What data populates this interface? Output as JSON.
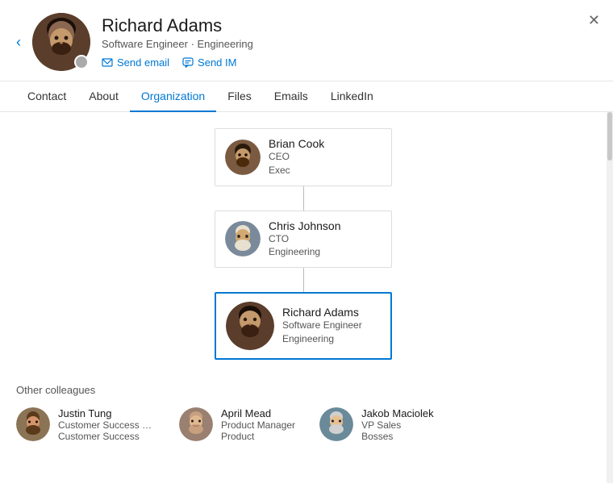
{
  "header": {
    "back_label": "‹",
    "close_label": "✕",
    "profile": {
      "name": "Richard Adams",
      "subtitle": "Software Engineer · Engineering",
      "send_email_label": "Send email",
      "send_im_label": "Send IM"
    }
  },
  "tabs": [
    {
      "id": "contact",
      "label": "Contact",
      "active": false
    },
    {
      "id": "about",
      "label": "About",
      "active": false
    },
    {
      "id": "organization",
      "label": "Organization",
      "active": true
    },
    {
      "id": "files",
      "label": "Files",
      "active": false
    },
    {
      "id": "emails",
      "label": "Emails",
      "active": false
    },
    {
      "id": "linkedin",
      "label": "LinkedIn",
      "active": false
    }
  ],
  "org_chart": {
    "nodes": [
      {
        "id": "brian",
        "name": "Brian Cook",
        "title": "CEO",
        "dept": "Exec",
        "current": false
      },
      {
        "id": "chris",
        "name": "Chris Johnson",
        "title": "CTO",
        "dept": "Engineering",
        "current": false
      },
      {
        "id": "richard",
        "name": "Richard Adams",
        "title": "Software Engineer",
        "dept": "Engineering",
        "current": true
      }
    ]
  },
  "colleagues": {
    "section_title": "Other colleagues",
    "items": [
      {
        "id": "justin",
        "name": "Justin Tung",
        "role": "Customer Success Man...",
        "dept": "Customer Success"
      },
      {
        "id": "april",
        "name": "April Mead",
        "role": "Product Manager",
        "dept": "Product"
      },
      {
        "id": "jakob",
        "name": "Jakob Maciolek",
        "role": "VP Sales",
        "dept": "Bosses"
      }
    ]
  }
}
